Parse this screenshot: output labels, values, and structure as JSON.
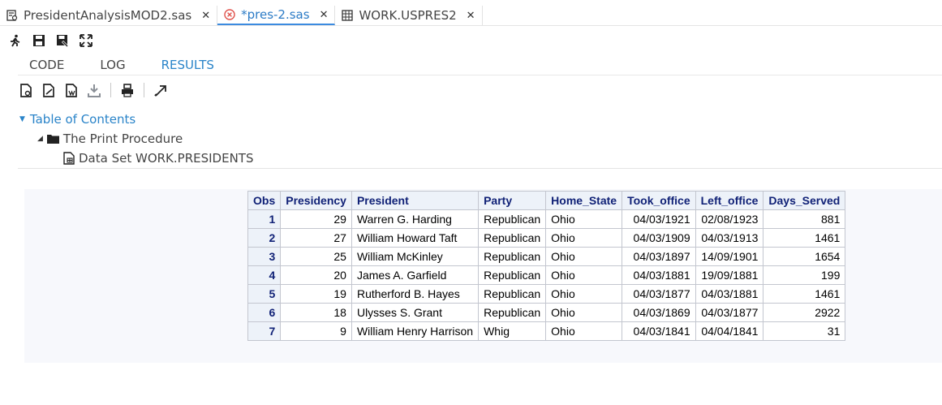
{
  "tabs": [
    {
      "label": "PresidentAnalysisMOD2.sas",
      "close": "✕"
    },
    {
      "label": "*pres-2.sas",
      "close": "✕"
    },
    {
      "label": "WORK.USPRES2",
      "close": "✕"
    }
  ],
  "subtabs": [
    "CODE",
    "LOG",
    "RESULTS"
  ],
  "toc": {
    "title": "Table of Contents",
    "procedure": "The Print Procedure",
    "dataset": "Data Set WORK.PRESIDENTS"
  },
  "table": {
    "headers": [
      "Obs",
      "Presidency",
      "President",
      "Party",
      "Home_State",
      "Took_office",
      "Left_office",
      "Days_Served"
    ],
    "rows": [
      [
        "1",
        "29",
        "Warren G. Harding",
        "Republican",
        "Ohio",
        "04/03/1921",
        "02/08/1923",
        "881"
      ],
      [
        "2",
        "27",
        "William Howard Taft",
        "Republican",
        "Ohio",
        "04/03/1909",
        "04/03/1913",
        "1461"
      ],
      [
        "3",
        "25",
        "William McKinley",
        "Republican",
        "Ohio",
        "04/03/1897",
        "14/09/1901",
        "1654"
      ],
      [
        "4",
        "20",
        "James A. Garfield",
        "Republican",
        "Ohio",
        "04/03/1881",
        "19/09/1881",
        "199"
      ],
      [
        "5",
        "19",
        "Rutherford B. Hayes",
        "Republican",
        "Ohio",
        "04/03/1877",
        "04/03/1881",
        "1461"
      ],
      [
        "6",
        "18",
        "Ulysses S. Grant",
        "Republican",
        "Ohio",
        "04/03/1869",
        "04/03/1877",
        "2922"
      ],
      [
        "7",
        "9",
        "William Henry Harrison",
        "Whig",
        "Ohio",
        "04/03/1841",
        "04/04/1841",
        "31"
      ]
    ]
  },
  "colors": {
    "accent": "#2a84c9",
    "header_text": "#112277",
    "header_bg": "#edf2f9",
    "error_icon": "#e0524c"
  }
}
